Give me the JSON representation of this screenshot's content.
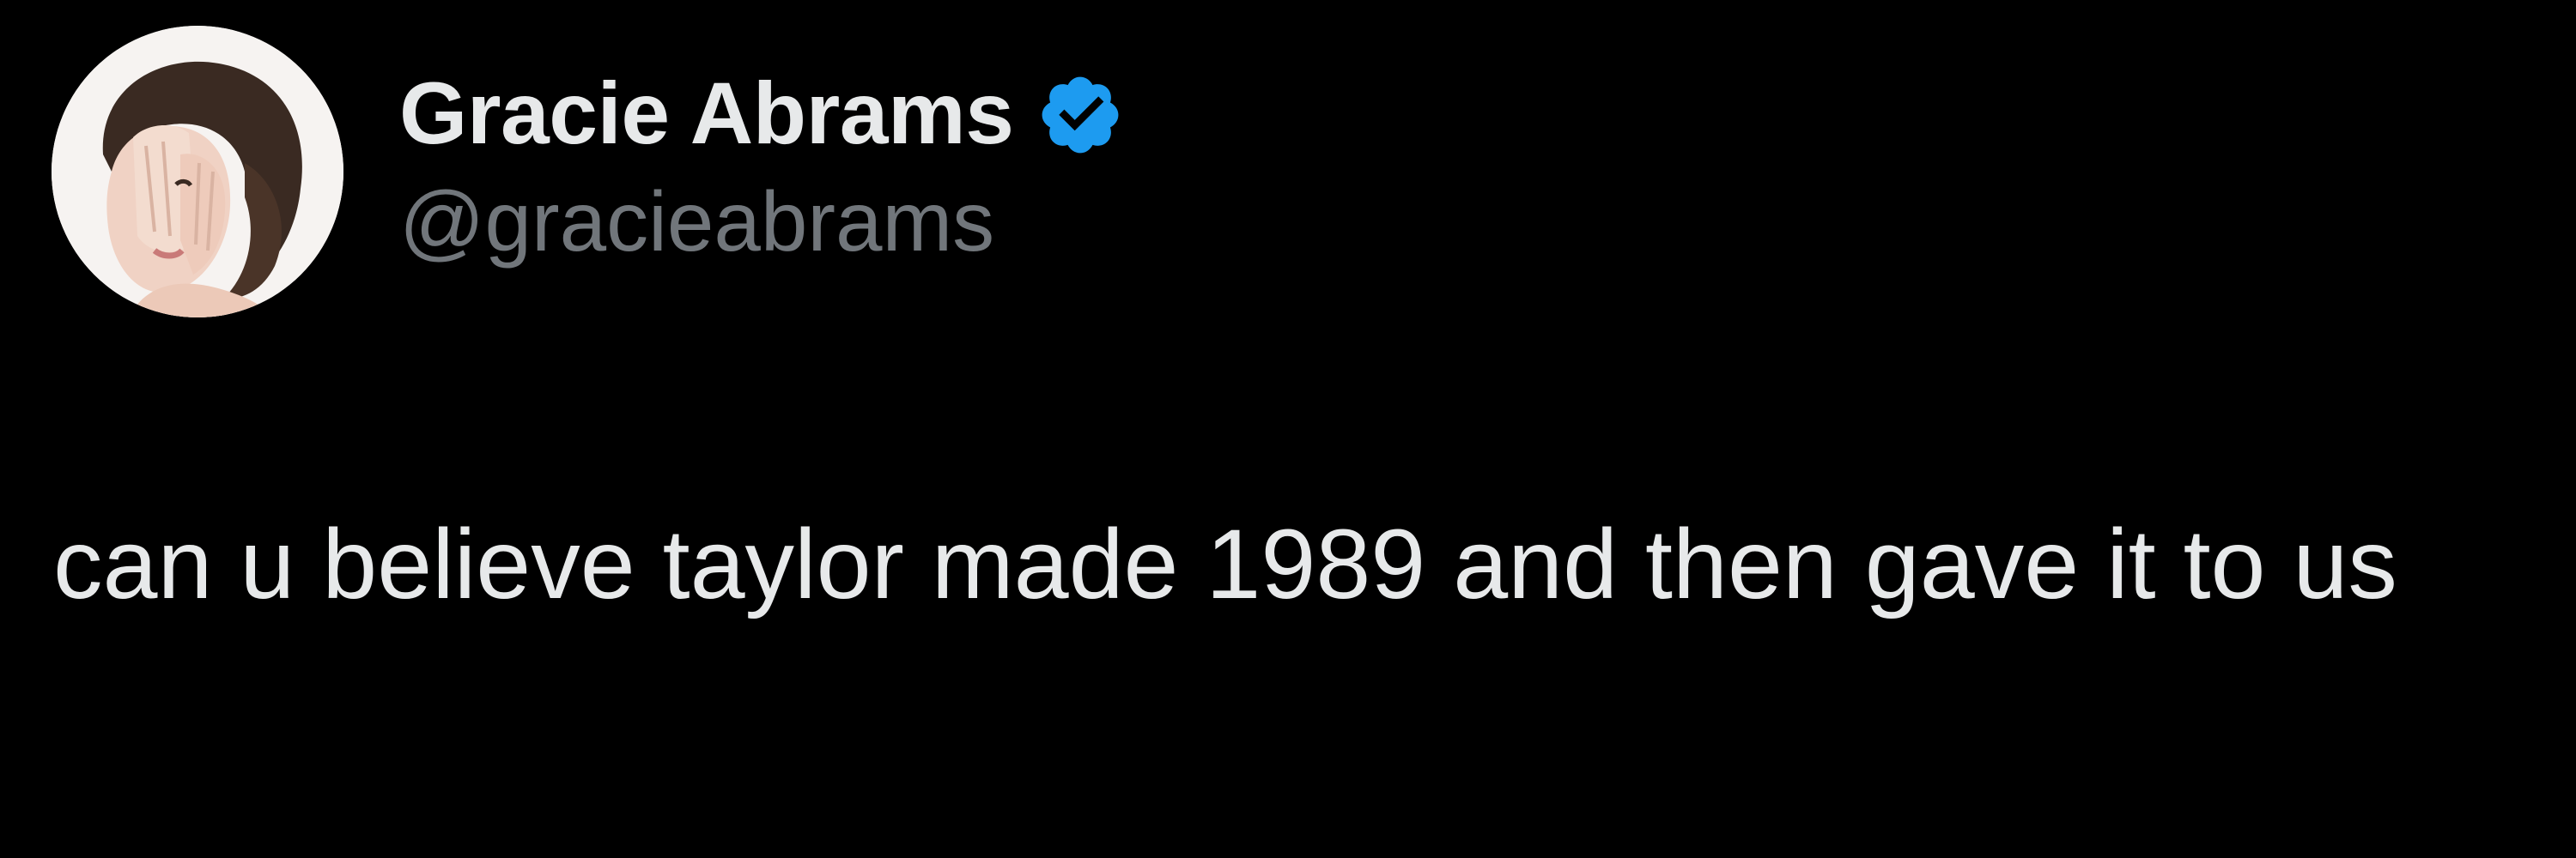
{
  "tweet": {
    "author": {
      "display_name": "Gracie Abrams",
      "handle": "@gracieabrams",
      "verified": true,
      "avatar_icon": "profile-photo",
      "verified_icon": "verified-badge-icon"
    },
    "text": "can u believe taylor made 1989 and then gave it to us"
  },
  "colors": {
    "background": "#000000",
    "primary_text": "#e7e9ea",
    "secondary_text": "#71767b",
    "verified_blue": "#1d9bf0"
  }
}
